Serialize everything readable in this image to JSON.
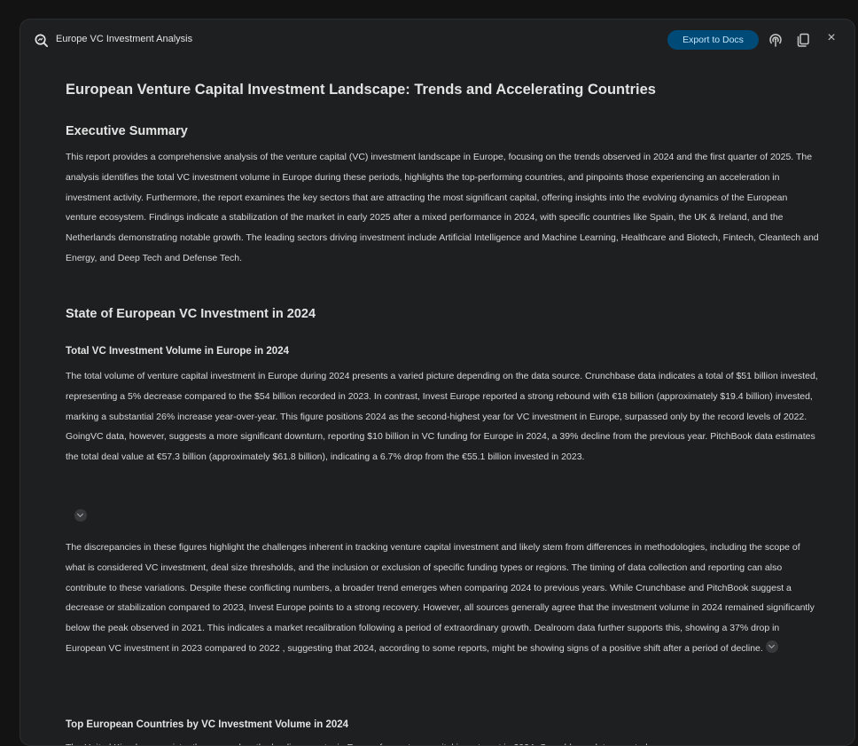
{
  "window": {
    "title": "Europe VC Investment Analysis",
    "export_label": "Export to Docs",
    "icons": [
      "app-logo-icon",
      "podcast-icon",
      "copy-icon",
      "close-icon"
    ],
    "close_glyph": "×"
  },
  "colors": {
    "background": "#131314",
    "panel": "#1e1f20",
    "export_button_bg": "#004a77",
    "export_button_text": "#c2e7ff",
    "text": "#e3e3e3"
  },
  "report": {
    "title": "European Venture Capital Investment Landscape: Trends and Accelerating Countries",
    "executive_summary": {
      "heading": "Executive Summary",
      "body": "This report provides a comprehensive analysis of the venture capital (VC) investment landscape in Europe, focusing on the trends observed in 2024 and the first quarter of 2025. The analysis identifies the total VC investment volume in Europe during these periods, highlights the top-performing countries, and pinpoints those experiencing an acceleration in investment activity. Furthermore, the report examines the key sectors that are attracting the most significant capital, offering insights into the evolving dynamics of the European venture ecosystem. Findings indicate a stabilization of the market in early 2025 after a mixed performance in 2024, with specific countries like Spain, the UK & Ireland, and the Netherlands demonstrating notable growth. The leading sectors driving investment include Artificial Intelligence and Machine Learning, Healthcare and Biotech, Fintech, Cleantech and Energy, and Deep Tech and Defense Tech."
    },
    "state_2024": {
      "heading": "State of European VC Investment in 2024",
      "total_volume": {
        "heading": "Total VC Investment Volume in Europe in 2024",
        "para1": "The total volume of venture capital investment in Europe during 2024 presents a varied picture depending on the data source. Crunchbase data indicates a total of $51 billion invested, representing a 5% decrease compared to the $54 billion recorded in 2023. In contrast, Invest Europe reported a strong rebound with €18 billion (approximately $19.4 billion) invested, marking a substantial 26% increase year-over-year. This figure positions 2024 as the second-highest year for VC investment in Europe, surpassed only by the record levels of 2022. GoingVC data, however, suggests a more significant downturn, reporting $10 billion in VC funding for Europe in 2024, a 39% decline from the previous year. PitchBook data estimates the total deal value at €57.3 billion (approximately $61.8 billion), indicating a 6.7% drop from the €55.1 billion invested in 2023.",
        "para2": "The discrepancies in these figures highlight the challenges inherent in tracking venture capital investment and likely stem from differences in methodologies, including the scope of what is considered VC investment, deal size thresholds, and the inclusion or exclusion of specific funding types or regions. The timing of data collection and reporting can also contribute to these variations. Despite these conflicting numbers, a broader trend emerges when comparing 2024 to previous years. While Crunchbase and PitchBook suggest a decrease or stabilization compared to 2023, Invest Europe points to a strong recovery. However, all sources generally agree that the investment volume in 2024 remained significantly below the peak observed in 2021. This indicates a market recalibration following a period of extraordinary growth. Dealroom data further supports this, showing a 37% drop in European VC investment in 2023 compared to 2022 , suggesting that 2024, according to some reports, might be showing signs of a positive shift after a period of decline."
      },
      "top_countries": {
        "heading": "Top European Countries by VC Investment Volume in 2024",
        "para1": "The United Kingdom consistently emerged as the leading country in Europe for venture capital investment in 2024. Crunchbase data reported"
      }
    }
  }
}
